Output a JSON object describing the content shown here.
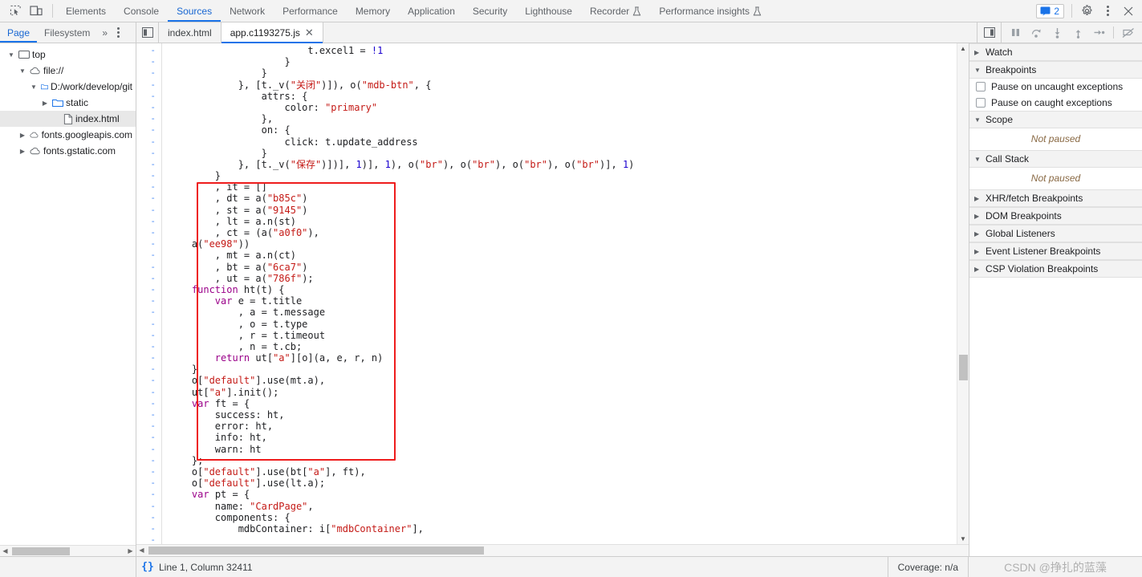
{
  "main_toolbar": {
    "icons": [
      {
        "name": "inspect-element-icon",
        "glyph": "inspect"
      },
      {
        "name": "device-toolbar-icon",
        "glyph": "device"
      }
    ],
    "tabs": [
      {
        "label": "Elements",
        "active": false,
        "experimental": false
      },
      {
        "label": "Console",
        "active": false,
        "experimental": false
      },
      {
        "label": "Sources",
        "active": true,
        "experimental": false
      },
      {
        "label": "Network",
        "active": false,
        "experimental": false
      },
      {
        "label": "Performance",
        "active": false,
        "experimental": false
      },
      {
        "label": "Memory",
        "active": false,
        "experimental": false
      },
      {
        "label": "Application",
        "active": false,
        "experimental": false
      },
      {
        "label": "Security",
        "active": false,
        "experimental": false
      },
      {
        "label": "Lighthouse",
        "active": false,
        "experimental": false
      },
      {
        "label": "Recorder",
        "active": false,
        "experimental": true
      },
      {
        "label": "Performance insights",
        "active": false,
        "experimental": true
      }
    ],
    "message_badge_count": "2",
    "settings_label": "gear-icon",
    "more_label": "more-options-icon",
    "close_label": "✕"
  },
  "sub_toolbar": {
    "nav_tabs": [
      {
        "label": "Page",
        "active": true
      },
      {
        "label": "Filesystem",
        "active": false
      }
    ],
    "overflow_label": "»",
    "editor_tabs": [
      {
        "label": "index.html",
        "active": false,
        "closable": false
      },
      {
        "label": "app.c1193275.js",
        "active": true,
        "closable": true,
        "close_glyph": "✕"
      }
    ],
    "debug_buttons": [
      {
        "name": "pause-script-execution-button",
        "glyph": "pause"
      },
      {
        "name": "step-over-button",
        "glyph": "step-over"
      },
      {
        "name": "step-into-button",
        "glyph": "step-into"
      },
      {
        "name": "step-out-button",
        "glyph": "step-out"
      },
      {
        "name": "step-button",
        "glyph": "step"
      },
      {
        "name": "deactivate-breakpoints-button",
        "glyph": "deactivate"
      }
    ]
  },
  "navigator": {
    "tree": [
      {
        "label": "top",
        "icon": "frame-icon",
        "indent": 0,
        "twisty": "open",
        "selected": false
      },
      {
        "label": "file://",
        "icon": "cloud-icon",
        "indent": 1,
        "twisty": "open",
        "selected": false
      },
      {
        "label": "D:/work/develop/git",
        "icon": "folder-blue-icon",
        "indent": 2,
        "twisty": "open",
        "selected": false
      },
      {
        "label": "static",
        "icon": "folder-blue-icon",
        "indent": 3,
        "twisty": "closed",
        "selected": false
      },
      {
        "label": "index.html",
        "icon": "document-icon",
        "indent": 4,
        "twisty": "none",
        "selected": true
      },
      {
        "label": "fonts.googleapis.com",
        "icon": "cloud-icon",
        "indent": 1,
        "twisty": "closed",
        "selected": false
      },
      {
        "label": "fonts.gstatic.com",
        "icon": "cloud-icon",
        "indent": 1,
        "twisty": "closed",
        "selected": false
      }
    ]
  },
  "editor": {
    "gutter_marker": "-",
    "line_count": 44,
    "lines": [
      [
        {
          "t": "                        ",
          "c": "plain"
        },
        {
          "t": "t.excel1 = ",
          "c": "plain"
        },
        {
          "t": "!1",
          "c": "num"
        }
      ],
      [
        {
          "t": "                    }",
          "c": "plain"
        }
      ],
      [
        {
          "t": "                }",
          "c": "plain"
        }
      ],
      [
        {
          "t": "            }, [t._v(",
          "c": "plain"
        },
        {
          "t": "\"关闭\"",
          "c": "str"
        },
        {
          "t": ")]), o(",
          "c": "plain"
        },
        {
          "t": "\"mdb-btn\"",
          "c": "str"
        },
        {
          "t": ", {",
          "c": "plain"
        }
      ],
      [
        {
          "t": "                attrs: {",
          "c": "plain"
        }
      ],
      [
        {
          "t": "                    color: ",
          "c": "plain"
        },
        {
          "t": "\"primary\"",
          "c": "str"
        }
      ],
      [
        {
          "t": "                },",
          "c": "plain"
        }
      ],
      [
        {
          "t": "                on: {",
          "c": "plain"
        }
      ],
      [
        {
          "t": "                    click: t.update_address",
          "c": "plain"
        }
      ],
      [
        {
          "t": "                }",
          "c": "plain"
        }
      ],
      [
        {
          "t": "            }, [t._v(",
          "c": "plain"
        },
        {
          "t": "\"保存\"",
          "c": "str"
        },
        {
          "t": ")])], ",
          "c": "plain"
        },
        {
          "t": "1",
          "c": "num"
        },
        {
          "t": ")], ",
          "c": "plain"
        },
        {
          "t": "1",
          "c": "num"
        },
        {
          "t": "), o(",
          "c": "plain"
        },
        {
          "t": "\"br\"",
          "c": "str"
        },
        {
          "t": "), o(",
          "c": "plain"
        },
        {
          "t": "\"br\"",
          "c": "str"
        },
        {
          "t": "), o(",
          "c": "plain"
        },
        {
          "t": "\"br\"",
          "c": "str"
        },
        {
          "t": "), o(",
          "c": "plain"
        },
        {
          "t": "\"br\"",
          "c": "str"
        },
        {
          "t": ")], ",
          "c": "plain"
        },
        {
          "t": "1",
          "c": "num"
        },
        {
          "t": ")",
          "c": "plain"
        }
      ],
      [
        {
          "t": "        }",
          "c": "plain"
        }
      ],
      [
        {
          "t": "        , it = []",
          "c": "plain"
        }
      ],
      [
        {
          "t": "        , dt = a(",
          "c": "plain"
        },
        {
          "t": "\"b85c\"",
          "c": "str"
        },
        {
          "t": ")",
          "c": "plain"
        }
      ],
      [
        {
          "t": "        , st = a(",
          "c": "plain"
        },
        {
          "t": "\"9145\"",
          "c": "str"
        },
        {
          "t": ")",
          "c": "plain"
        }
      ],
      [
        {
          "t": "        , lt = a.n(st)",
          "c": "plain"
        }
      ],
      [
        {
          "t": "        , ct = (a(",
          "c": "plain"
        },
        {
          "t": "\"a0f0\"",
          "c": "str"
        },
        {
          "t": "),",
          "c": "plain"
        }
      ],
      [
        {
          "t": "    a(",
          "c": "plain"
        },
        {
          "t": "\"ee98\"",
          "c": "str"
        },
        {
          "t": "))",
          "c": "plain"
        }
      ],
      [
        {
          "t": "        , mt = a.n(ct)",
          "c": "plain"
        }
      ],
      [
        {
          "t": "        , bt = a(",
          "c": "plain"
        },
        {
          "t": "\"6ca7\"",
          "c": "str"
        },
        {
          "t": ")",
          "c": "plain"
        }
      ],
      [
        {
          "t": "        , ut = a(",
          "c": "plain"
        },
        {
          "t": "\"786f\"",
          "c": "str"
        },
        {
          "t": ");",
          "c": "plain"
        }
      ],
      [
        {
          "t": "    ",
          "c": "plain"
        },
        {
          "t": "function",
          "c": "kw"
        },
        {
          "t": " ht(t) {",
          "c": "plain"
        }
      ],
      [
        {
          "t": "        ",
          "c": "plain"
        },
        {
          "t": "var",
          "c": "kw"
        },
        {
          "t": " e = t.title",
          "c": "plain"
        }
      ],
      [
        {
          "t": "            , a = t.message",
          "c": "plain"
        }
      ],
      [
        {
          "t": "            , o = t.type",
          "c": "plain"
        }
      ],
      [
        {
          "t": "            , r = t.timeout",
          "c": "plain"
        }
      ],
      [
        {
          "t": "            , n = t.cb;",
          "c": "plain"
        }
      ],
      [
        {
          "t": "        ",
          "c": "plain"
        },
        {
          "t": "return",
          "c": "kw"
        },
        {
          "t": " ut[",
          "c": "plain"
        },
        {
          "t": "\"a\"",
          "c": "str"
        },
        {
          "t": "][o](a, e, r, n)",
          "c": "plain"
        }
      ],
      [
        {
          "t": "    }",
          "c": "plain"
        }
      ],
      [
        {
          "t": "    o[",
          "c": "plain"
        },
        {
          "t": "\"default\"",
          "c": "str"
        },
        {
          "t": "].use(mt.a),",
          "c": "plain"
        }
      ],
      [
        {
          "t": "    ut[",
          "c": "plain"
        },
        {
          "t": "\"a\"",
          "c": "str"
        },
        {
          "t": "].init();",
          "c": "plain"
        }
      ],
      [
        {
          "t": "    ",
          "c": "plain"
        },
        {
          "t": "var",
          "c": "kw"
        },
        {
          "t": " ft = {",
          "c": "plain"
        }
      ],
      [
        {
          "t": "        success: ht,",
          "c": "plain"
        }
      ],
      [
        {
          "t": "        error: ht,",
          "c": "plain"
        }
      ],
      [
        {
          "t": "        info: ht,",
          "c": "plain"
        }
      ],
      [
        {
          "t": "        warn: ht",
          "c": "plain"
        }
      ],
      [
        {
          "t": "    };",
          "c": "plain"
        }
      ],
      [
        {
          "t": "    o[",
          "c": "plain"
        },
        {
          "t": "\"default\"",
          "c": "str"
        },
        {
          "t": "].use(bt[",
          "c": "plain"
        },
        {
          "t": "\"a\"",
          "c": "str"
        },
        {
          "t": "], ft),",
          "c": "plain"
        }
      ],
      [
        {
          "t": "    o[",
          "c": "plain"
        },
        {
          "t": "\"default\"",
          "c": "str"
        },
        {
          "t": "].use(lt.a);",
          "c": "plain"
        }
      ],
      [
        {
          "t": "    ",
          "c": "plain"
        },
        {
          "t": "var",
          "c": "kw"
        },
        {
          "t": " pt = {",
          "c": "plain"
        }
      ],
      [
        {
          "t": "        name: ",
          "c": "plain"
        },
        {
          "t": "\"CardPage\"",
          "c": "str"
        },
        {
          "t": ",",
          "c": "plain"
        }
      ],
      [
        {
          "t": "        components: {",
          "c": "plain"
        }
      ],
      [
        {
          "t": "            mdbContainer: i[",
          "c": "plain"
        },
        {
          "t": "\"mdbContainer\"",
          "c": "str"
        },
        {
          "t": "],",
          "c": "plain"
        }
      ]
    ],
    "annotation": {
      "name": "red-highlight-box",
      "color": "#ee1c1c"
    }
  },
  "debug_sidebar": {
    "sections": [
      {
        "title": "Watch",
        "expanded": false,
        "body": null
      },
      {
        "title": "Breakpoints",
        "expanded": true,
        "body": "checkboxes"
      },
      {
        "title": "Scope",
        "expanded": true,
        "body": "not-paused"
      },
      {
        "title": "Call Stack",
        "expanded": true,
        "body": "not-paused"
      },
      {
        "title": "XHR/fetch Breakpoints",
        "expanded": false,
        "body": null
      },
      {
        "title": "DOM Breakpoints",
        "expanded": false,
        "body": null
      },
      {
        "title": "Global Listeners",
        "expanded": false,
        "body": null
      },
      {
        "title": "Event Listener Breakpoints",
        "expanded": false,
        "body": null
      },
      {
        "title": "CSP Violation Breakpoints",
        "expanded": false,
        "body": null
      }
    ],
    "breakpoint_options": [
      {
        "label": "Pause on uncaught exceptions",
        "checked": false
      },
      {
        "label": "Pause on caught exceptions",
        "checked": false
      }
    ],
    "not_paused_text": "Not paused"
  },
  "statusbar": {
    "pretty_print_label": "{}",
    "cursor_position": "Line 1, Column 32411",
    "coverage": "Coverage: n/a",
    "watermark": "CSDN @挣扎的蓝藻"
  }
}
